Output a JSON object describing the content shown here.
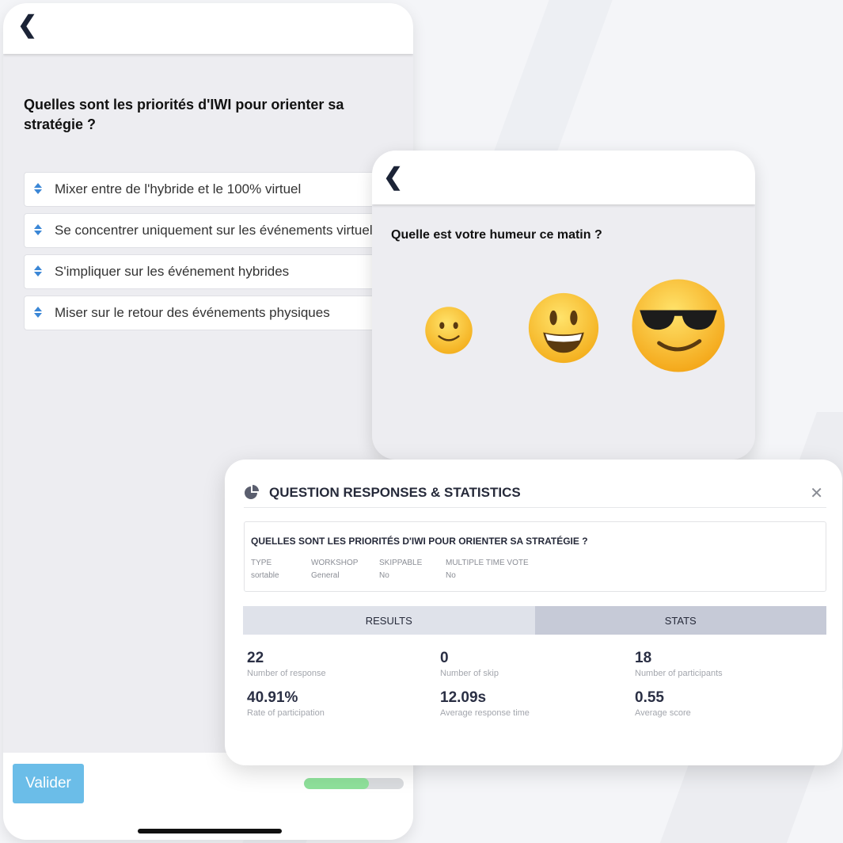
{
  "poll": {
    "question": "Quelles sont les priorités d'IWI pour orienter sa stratégie ?",
    "options": [
      "Mixer entre de l'hybride et le 100% virtuel",
      "Se concentrer uniquement sur les événements virtuels",
      "S'impliquer sur les événement hybrides",
      "Miser sur le retour des événements physiques"
    ],
    "submit_label": "Valider",
    "progress": 0.65,
    "back_icon": "chevron-left-icon"
  },
  "mood": {
    "question": "Quelle est votre humeur ce matin ?",
    "choices": [
      "slightly-smiling-face-icon",
      "grinning-face-icon",
      "sunglasses-face-icon"
    ]
  },
  "stats_modal": {
    "title": "QUESTION RESPONSES & STATISTICS",
    "icon": "pie-chart-icon",
    "close_icon": "close-icon",
    "question": "QUELLES SONT LES PRIORITÉS D'IWI POUR ORIENTER SA STRATÉGIE ?",
    "meta": [
      {
        "key": "TYPE",
        "value": "sortable"
      },
      {
        "key": "WORKSHOP",
        "value": "General"
      },
      {
        "key": "SKIPPABLE",
        "value": "No"
      },
      {
        "key": "MULTIPLE TIME VOTE",
        "value": "No"
      }
    ],
    "tabs": [
      "RESULTS",
      "STATS"
    ],
    "stats": [
      {
        "value": "22",
        "label": "Number of response"
      },
      {
        "value": "0",
        "label": "Number of skip"
      },
      {
        "value": "18",
        "label": "Number of participants"
      },
      {
        "value": "40.91%",
        "label": "Rate of participation"
      },
      {
        "value": "12.09s",
        "label": "Average response time"
      },
      {
        "value": "0.55",
        "label": "Average score"
      }
    ]
  },
  "colors": {
    "accent_blue": "#3b87d6",
    "button_blue": "#6bbde8",
    "progress_green": "#8fe19b",
    "dark_text": "#262a3a"
  }
}
